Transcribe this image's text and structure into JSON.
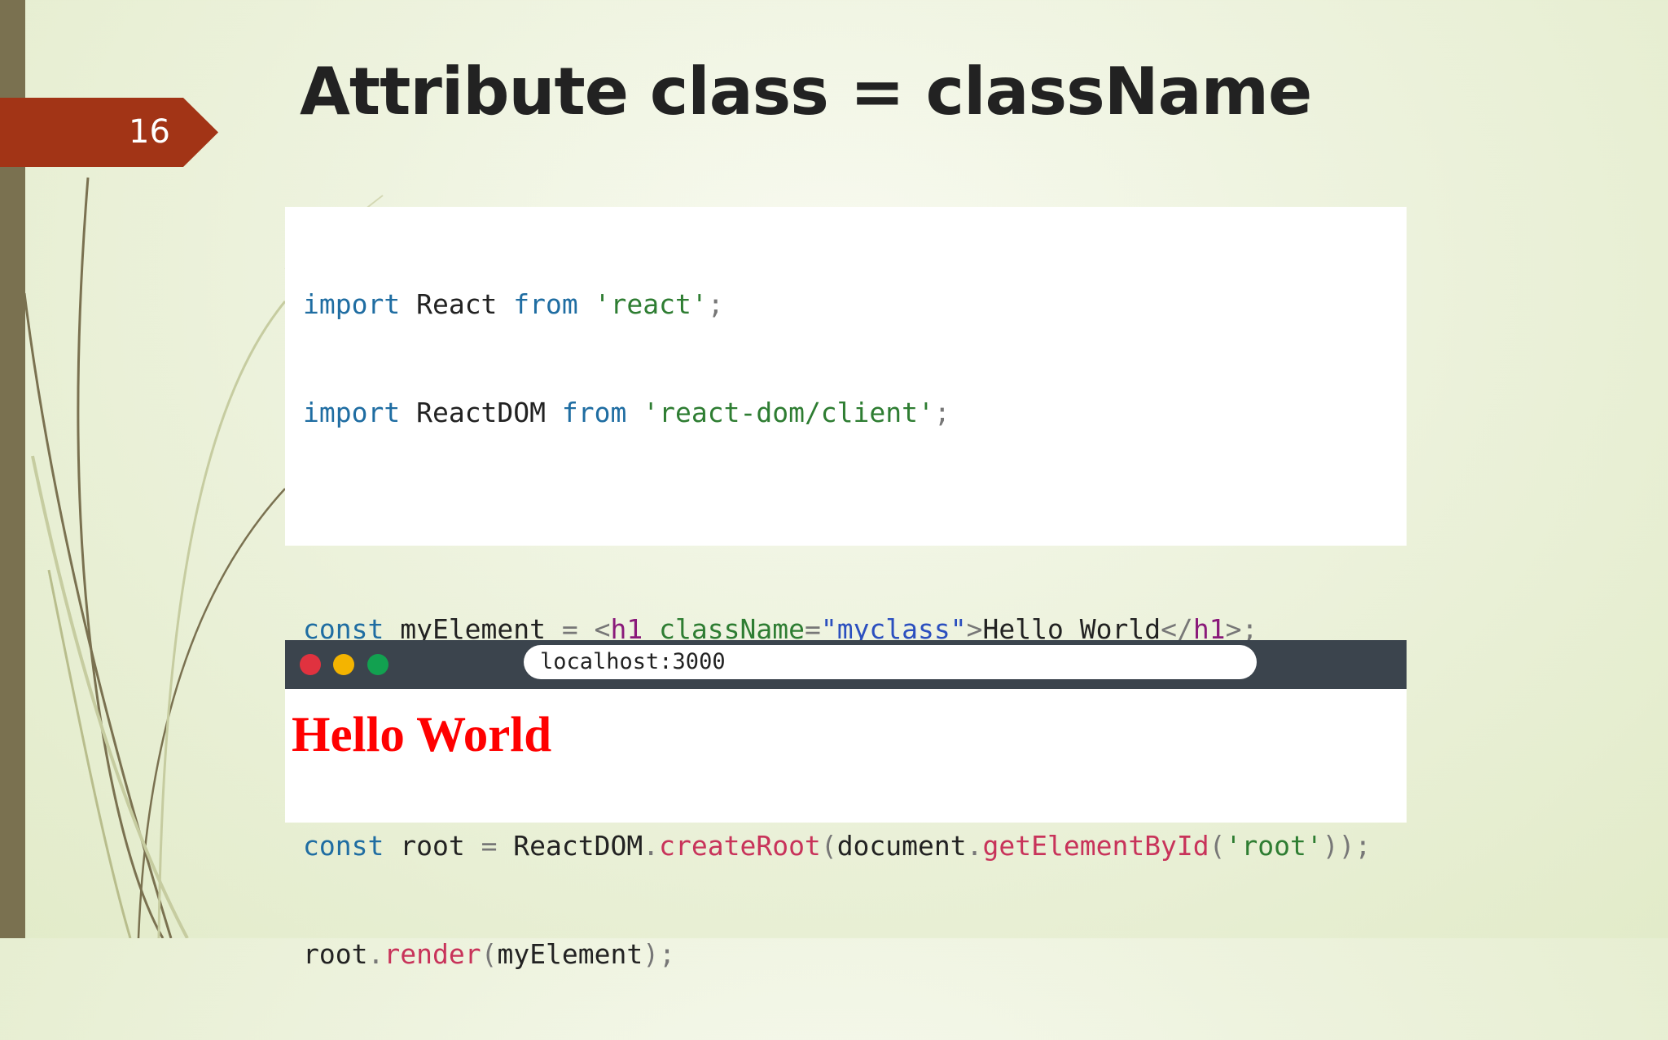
{
  "slide": {
    "number": "16",
    "title": "Attribute class = className"
  },
  "code": {
    "line1": {
      "kw1": "import",
      "name": " React ",
      "kw2": "from",
      "sp": " ",
      "str": "'react'",
      "end": ";"
    },
    "line2": {
      "kw1": "import",
      "name": " ReactDOM ",
      "kw2": "from",
      "sp": " ",
      "str": "'react-dom/client'",
      "end": ";"
    },
    "line3": {
      "kw": "const",
      "name": " myElement ",
      "eq": "=",
      "sp": " ",
      "lt": "<",
      "tag": "h1",
      "sp2": " ",
      "attr": "className",
      "eq2": "=",
      "val": "\"myclass\"",
      "gt": ">",
      "text": "Hello World",
      "close_lt": "</",
      "close_tag": "h1",
      "close_gt": ">",
      "end": ";"
    },
    "line4": {
      "kw": "const",
      "name": " root ",
      "eq": "=",
      "obj": " ReactDOM",
      "dot": ".",
      "fn": "createRoot",
      "p1": "(",
      "doc": "document",
      "dot2": ".",
      "fn2": "getElementById",
      "p2": "(",
      "str": "'root'",
      "p3": "))",
      "end": ";"
    },
    "line5": {
      "obj": "root",
      "dot": ".",
      "fn": "render",
      "p1": "(",
      "arg": "myElement",
      "p2": ")",
      "end": ";"
    }
  },
  "browser": {
    "url": "localhost:3000",
    "output_heading": "Hello World"
  },
  "colors": {
    "accent_tab": "#a23416",
    "left_bar": "#7a7150",
    "output_text": "#ff0000",
    "browser_bar": "#3b444d"
  }
}
